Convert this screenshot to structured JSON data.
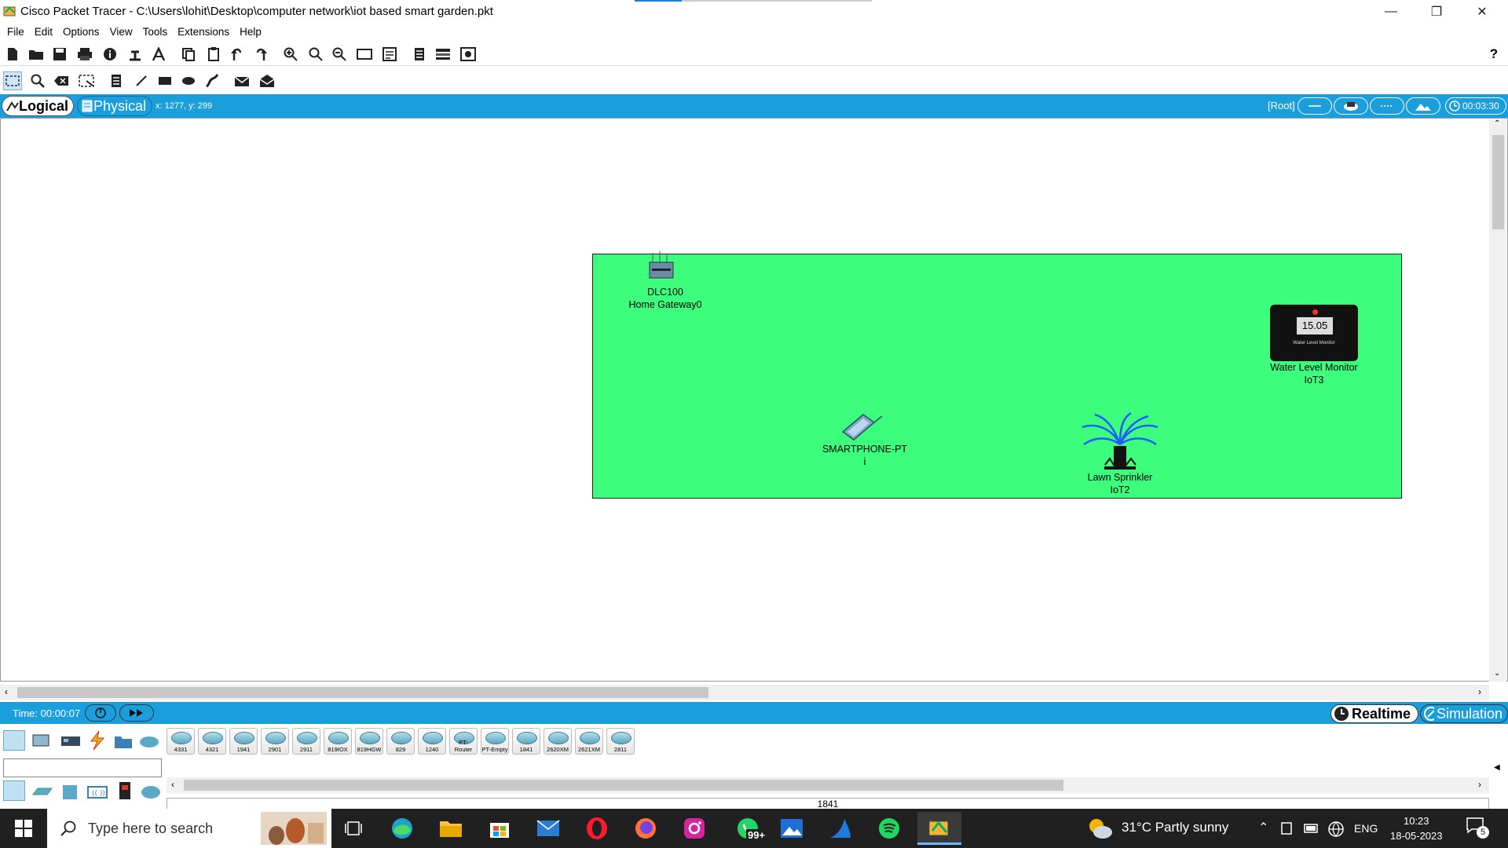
{
  "window": {
    "title": "Cisco Packet Tracer - C:\\Users\\lohit\\Desktop\\computer network\\iot based smart garden.pkt",
    "controls": [
      "minimize",
      "restore",
      "close"
    ]
  },
  "menu": {
    "items": [
      "File",
      "Edit",
      "Options",
      "View",
      "Tools",
      "Extensions",
      "Help"
    ]
  },
  "toolbar": {
    "help_label": "?"
  },
  "viewbar": {
    "logical_label": "Logical",
    "physical_label": "Physical",
    "coords": "x: 1277, y: 299",
    "root_label": "[Root]",
    "clock": "00:03:30"
  },
  "workspace": {
    "background": "#3cfe7c",
    "devices": [
      {
        "line1": "DLC100",
        "line2": "Home Gateway0",
        "icon": "home-gateway-icon"
      },
      {
        "line1": "Water Level Monitor",
        "line2": "IoT3",
        "icon": "water-level-monitor-icon",
        "reading": "15.05",
        "panel_text": "Water Level Monitor"
      },
      {
        "line1": "SMARTPHONE-PT",
        "line2": "i",
        "icon": "smartphone-icon"
      },
      {
        "line1": "Lawn Sprinkler",
        "line2": "IoT2",
        "icon": "lawn-sprinkler-icon"
      }
    ]
  },
  "timebar": {
    "time": "Time: 00:00:07",
    "realtime_label": "Realtime",
    "simulation_label": "Simulation"
  },
  "device_panel": {
    "models": [
      "4331",
      "4321",
      "1941",
      "2901",
      "2911",
      "819IOX",
      "819HGW",
      "829",
      "1240",
      "PT-Router",
      "PT-Empty",
      "1841",
      "2620XM",
      "2621XM",
      "2811"
    ],
    "selected_model": "1841"
  },
  "taskbar": {
    "search_placeholder": "Type here to search",
    "whatsapp_badge": "99+",
    "weather": "31°C  Partly sunny",
    "language": "ENG",
    "time": "10:23",
    "date": "18-05-2023",
    "notifications": "5"
  }
}
